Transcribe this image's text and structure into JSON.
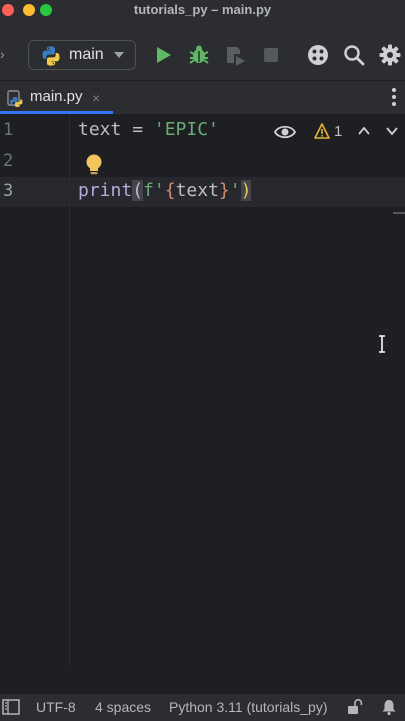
{
  "window": {
    "title": "tutorials_py – main.py"
  },
  "toolbar": {
    "run_config_label": "main",
    "icons": [
      "run-icon",
      "debug-icon",
      "coverage-icon",
      "stop-icon",
      "plugins-icon",
      "search-icon",
      "gear-icon"
    ]
  },
  "tabs": [
    {
      "label": "main.py",
      "close": "×",
      "active": true
    }
  ],
  "editor": {
    "line_numbers": [
      "1",
      "2",
      "3"
    ],
    "lines": {
      "line1": {
        "var": "text",
        "op": " = ",
        "str": "'EPIC'"
      },
      "line3": {
        "fn": "print",
        "open": "(",
        "fprefix": "f'",
        "lbrace": "{",
        "expr": "text",
        "rbrace": "}",
        "quote": "'",
        "close": ")"
      }
    },
    "inspection": {
      "warning_count": "1"
    }
  },
  "status_bar": {
    "encoding": "UTF-8",
    "indent": "4 spaces",
    "interpreter": "Python 3.11 (tutorials_py)"
  },
  "colors": {
    "accent": "#3574f0",
    "run_green": "#5fb865",
    "string_green": "#6aab73",
    "bulb_yellow": "#f2c55c",
    "warning_yellow": "#e8b339"
  }
}
